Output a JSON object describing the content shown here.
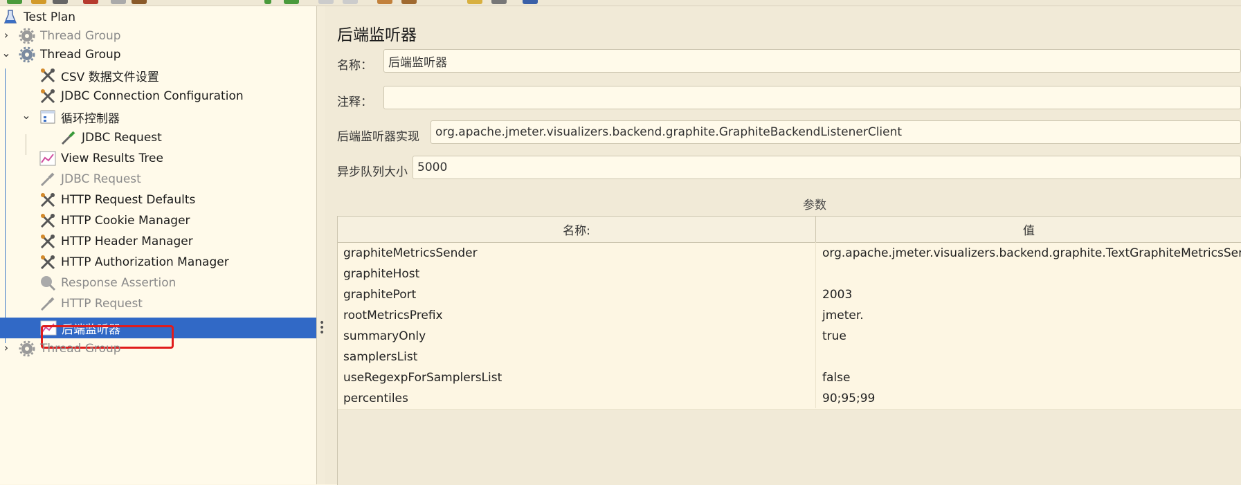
{
  "tree": {
    "items": [
      {
        "label": "Test Plan",
        "icon": "flask-icon"
      },
      {
        "label": "Thread Group",
        "icon": "gear-icon"
      },
      {
        "label": "Thread Group",
        "icon": "gear-icon"
      },
      {
        "label": "CSV 数据文件设置",
        "icon": "wrench-icon"
      },
      {
        "label": "JDBC Connection Configuration",
        "icon": "wrench-icon"
      },
      {
        "label": "循环控制器",
        "icon": "loop-controller-icon"
      },
      {
        "label": "JDBC Request",
        "icon": "pipette-icon"
      },
      {
        "label": "View Results Tree",
        "icon": "chart-icon"
      },
      {
        "label": "JDBC Request",
        "icon": "pipette-icon"
      },
      {
        "label": "HTTP Request Defaults",
        "icon": "wrench-icon"
      },
      {
        "label": "HTTP Cookie Manager",
        "icon": "wrench-icon"
      },
      {
        "label": "HTTP Header Manager",
        "icon": "wrench-icon"
      },
      {
        "label": "HTTP Authorization Manager",
        "icon": "wrench-icon"
      },
      {
        "label": "Response Assertion",
        "icon": "magnifier-icon"
      },
      {
        "label": "HTTP Request",
        "icon": "pipette-icon"
      },
      {
        "label": "后端监听器",
        "icon": "chart-icon"
      },
      {
        "label": "Thread Group",
        "icon": "gear-icon"
      }
    ],
    "selected_index": 15
  },
  "panel": {
    "title": "后端监听器",
    "name_label": "名称：",
    "name_value": "后端监听器",
    "comment_label": "注释：",
    "comment_value": "",
    "impl_label": "后端监听器实现",
    "impl_value": "org.apache.jmeter.visualizers.backend.graphite.GraphiteBackendListenerClient",
    "queue_label": "异步队列大小",
    "queue_value": "5000",
    "params_label": "参数"
  },
  "table": {
    "columns": [
      "名称:",
      "值"
    ],
    "rows": [
      [
        "graphiteMetricsSender",
        "org.apache.jmeter.visualizers.backend.graphite.TextGraphiteMetricsSender"
      ],
      [
        "graphiteHost",
        ""
      ],
      [
        "graphitePort",
        "2003"
      ],
      [
        "rootMetricsPrefix",
        "jmeter."
      ],
      [
        "summaryOnly",
        "true"
      ],
      [
        "samplersList",
        ""
      ],
      [
        "useRegexpForSamplersList",
        "false"
      ],
      [
        "percentiles",
        "90;95;99"
      ]
    ]
  },
  "colors": {
    "selection": "#3169c6",
    "highlight_border": "#e01b1b",
    "panel_bg": "#f1ead7",
    "tree_bg": "#fffaea"
  }
}
